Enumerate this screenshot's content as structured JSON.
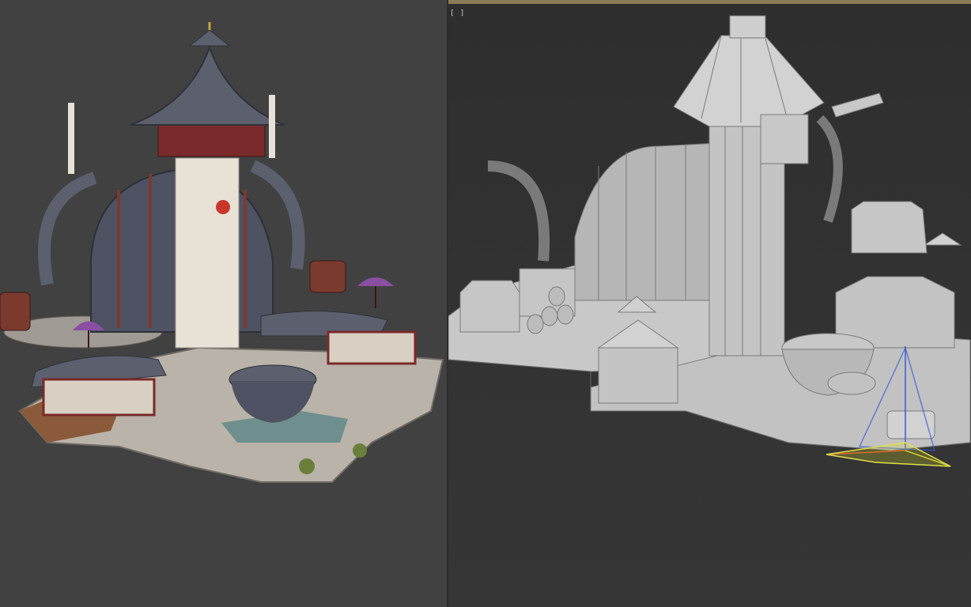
{
  "colors": {
    "left_background": "#414141",
    "right_background": "#333333",
    "viewport_border": "#8a7a58",
    "roof_slate": "#5b5f6e",
    "wood_red": "#7a2a2a",
    "plaster": "#e8e2d6",
    "accent_purple": "#8a4fa3",
    "wireframe_fill": "#bdbdbd",
    "wireframe_edge": "#7a7a7a"
  },
  "left_view": {
    "name": "textured-render"
  },
  "right_view": {
    "name": "wireframe-viewport",
    "menu_label": "[ ]",
    "gizmo_axes": [
      "x",
      "y",
      "z"
    ]
  }
}
